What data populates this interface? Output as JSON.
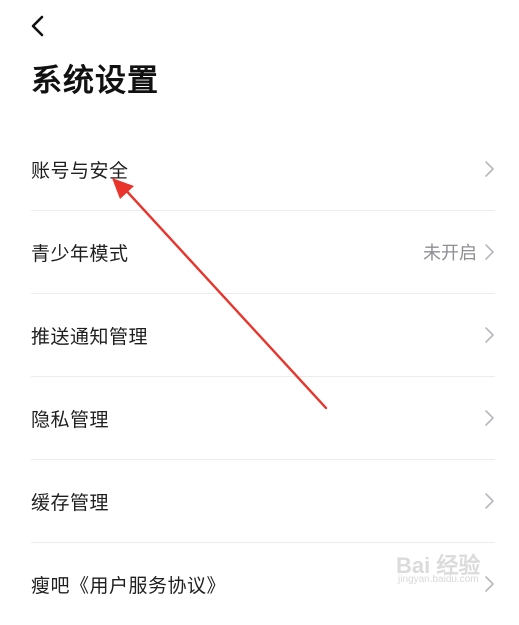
{
  "header": {
    "title": "系统设置"
  },
  "settings": {
    "items": [
      {
        "label": "账号与安全",
        "value": ""
      },
      {
        "label": "青少年模式",
        "value": "未开启"
      },
      {
        "label": "推送通知管理",
        "value": ""
      },
      {
        "label": "隐私管理",
        "value": ""
      },
      {
        "label": "缓存管理",
        "value": ""
      },
      {
        "label": "瘦吧《用户服务协议》",
        "value": ""
      }
    ]
  },
  "annotation": {
    "arrow_color": "#e8342b"
  },
  "watermark": {
    "brand": "Bai 经验",
    "url": "jingyan.baidu.com"
  }
}
